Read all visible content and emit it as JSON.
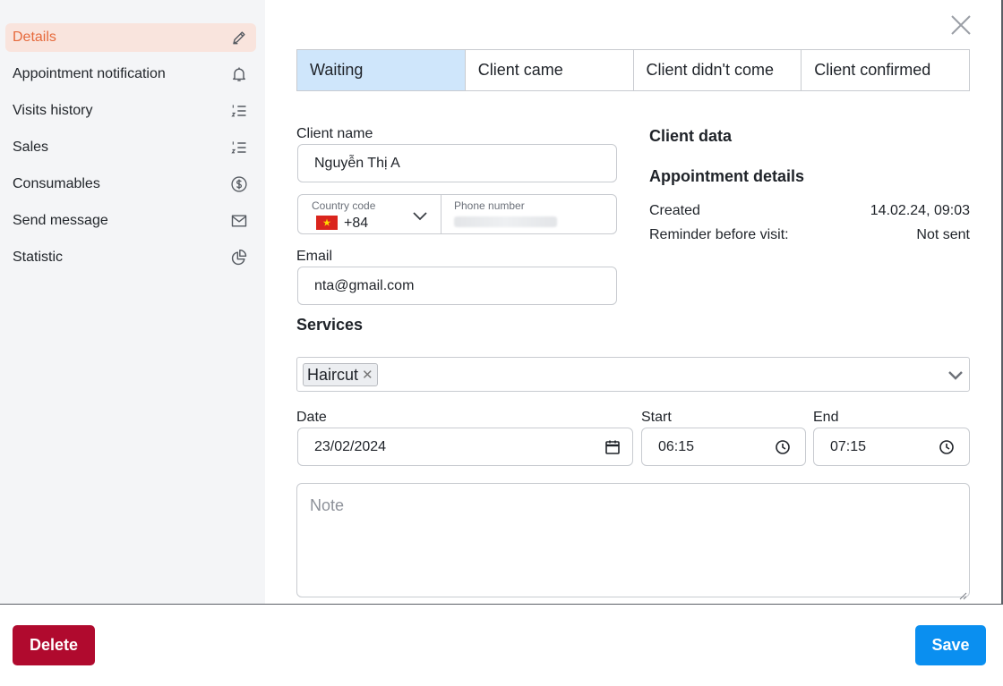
{
  "sidebar": {
    "items": [
      {
        "label": "Details",
        "icon": "edit-icon",
        "active": true
      },
      {
        "label": "Appointment notification",
        "icon": "bell-icon"
      },
      {
        "label": "Visits history",
        "icon": "list-icon"
      },
      {
        "label": "Sales",
        "icon": "list-icon"
      },
      {
        "label": "Consumables",
        "icon": "dollar-icon"
      },
      {
        "label": "Send message",
        "icon": "mail-icon"
      },
      {
        "label": "Statistic",
        "icon": "pie-chart-icon"
      }
    ]
  },
  "status_tabs": [
    {
      "label": "Waiting",
      "active": true
    },
    {
      "label": "Client came"
    },
    {
      "label": "Client didn't come"
    },
    {
      "label": "Client confirmed"
    }
  ],
  "form": {
    "client_name_label": "Client name",
    "client_name_value": "Nguyễn Thị A",
    "country_code_label": "Country code",
    "country_code_value": "+84",
    "phone_label": "Phone number",
    "email_label": "Email",
    "email_value": "nta@gmail.com",
    "services_title": "Services",
    "services": [
      {
        "label": "Haircut"
      }
    ],
    "date_label": "Date",
    "date_value": "23/02/2024",
    "start_label": "Start",
    "start_value": "06:15",
    "end_label": "End",
    "end_value": "07:15",
    "note_placeholder": "Note"
  },
  "client_data": {
    "title": "Client data",
    "appointment_title": "Appointment details",
    "created_label": "Created",
    "created_value": "14.02.24, 09:03",
    "reminder_label": "Reminder before visit:",
    "reminder_value": "Not sent"
  },
  "footer": {
    "delete_label": "Delete",
    "save_label": "Save"
  },
  "colors": {
    "accent": "#e66a3c",
    "active_tab": "#cfe6fb",
    "delete": "#b00a2e",
    "save": "#0a8ff0"
  }
}
